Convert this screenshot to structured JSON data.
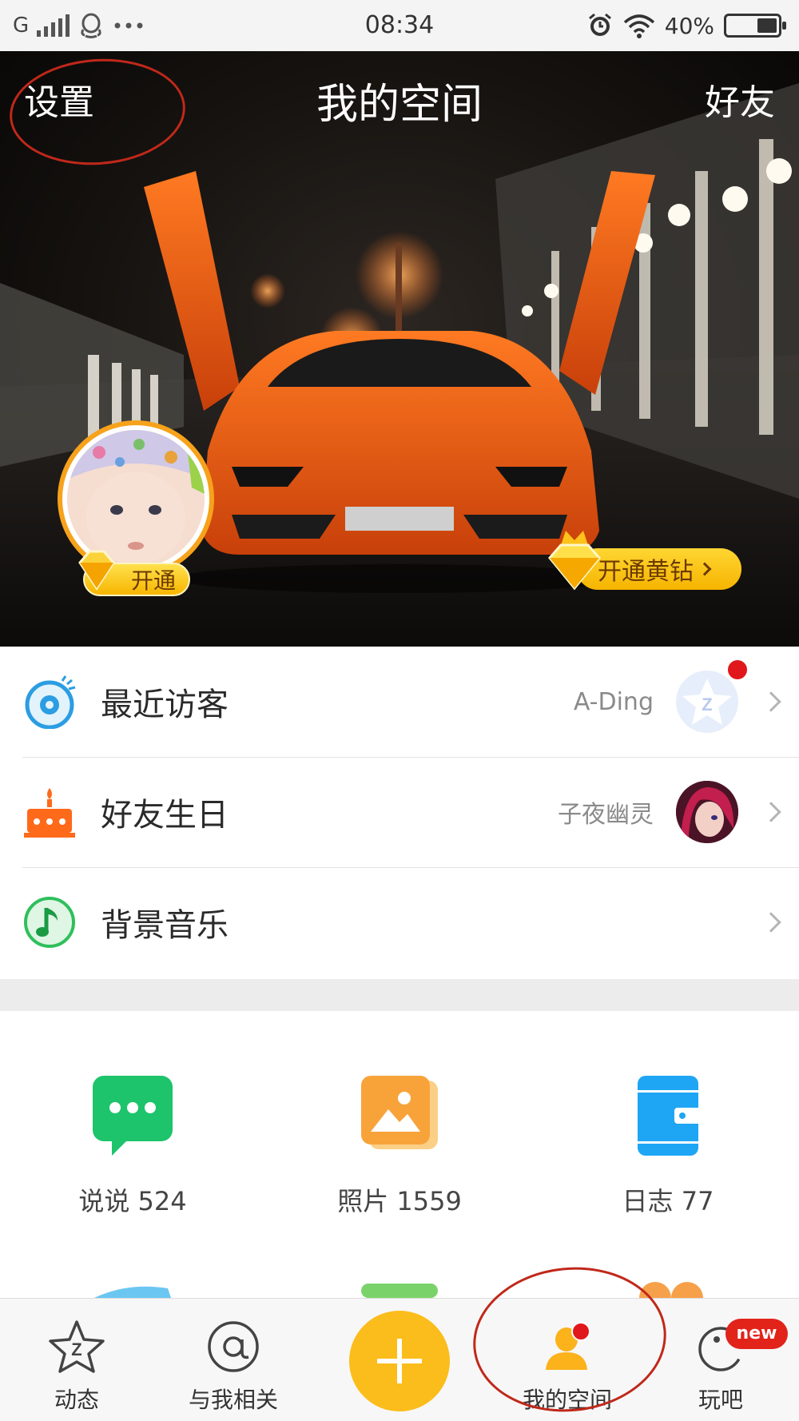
{
  "status_bar": {
    "network": "G",
    "time": "08:34",
    "battery": "40%",
    "battery_level": 0.4,
    "icons": [
      "signal-icon",
      "qq-icon",
      "more-icon",
      "alarm-icon",
      "wifi-icon",
      "battery-icon"
    ]
  },
  "header": {
    "settings": "设置",
    "title": "我的空间",
    "friends": "好友"
  },
  "profile": {
    "open_label": "开通",
    "yellow_diamond_label": "开通黄钻"
  },
  "rows": [
    {
      "label": "最近访客",
      "value": "A-Ding",
      "icon": "eye-icon",
      "has_dot": true
    },
    {
      "label": "好友生日",
      "value": "子夜幽灵",
      "icon": "cake-icon",
      "has_dot": false
    },
    {
      "label": "背景音乐",
      "value": "",
      "icon": "music-note-icon",
      "has_dot": false
    }
  ],
  "grid": [
    {
      "label": "说说 524",
      "icon": "chat-bubble-icon",
      "color": "#1dc46b"
    },
    {
      "label": "照片 1559",
      "icon": "photo-icon",
      "color": "#f8a33a"
    },
    {
      "label": "日志 77",
      "icon": "diary-icon",
      "color": "#1ea6f5"
    }
  ],
  "nav": {
    "items": [
      {
        "label": "动态",
        "icon": "star-z-icon"
      },
      {
        "label": "与我相关",
        "icon": "at-icon"
      },
      {
        "label": "我的空间",
        "icon": "my-space-icon"
      },
      {
        "label": "玩吧",
        "icon": "game-icon"
      }
    ],
    "plus": "add-icon",
    "new_badge": "new"
  },
  "colors": {
    "accent_yellow": "#fbbd1b",
    "annotation_red": "#c0281a",
    "notify_red": "#e0181b"
  }
}
